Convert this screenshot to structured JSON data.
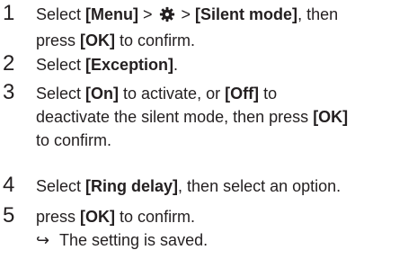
{
  "steps": [
    {
      "number": "1",
      "text_1": "Select ",
      "menu_key": "[Menu]",
      "sep_1": " > ",
      "sep_2": " > ",
      "silent_key": "[Silent mode]",
      "text_2": ", then",
      "text_3": "press ",
      "ok_key": "[OK]",
      "text_4": " to confirm.",
      "icon": "gear-icon"
    },
    {
      "number": "2",
      "text_1": "Select ",
      "exception_key": "[Exception]",
      "text_2": "."
    },
    {
      "number": "3",
      "text_1": "Select ",
      "on_key": "[On]",
      "text_2": " to activate, or ",
      "off_key": "[Off]",
      "text_3": " to",
      "text_4": "deactivate the silent mode, then press ",
      "ok_key": "[OK]",
      "text_5": "to confirm."
    },
    {
      "number": "4",
      "text_1": "Select ",
      "ring_key": "[Ring delay]",
      "text_2": ", then select an option."
    },
    {
      "number": "5",
      "text_1": "press ",
      "ok_key": "[OK]",
      "text_2": " to confirm.",
      "result_arrow": "↪",
      "result_text": "The setting is saved."
    }
  ]
}
